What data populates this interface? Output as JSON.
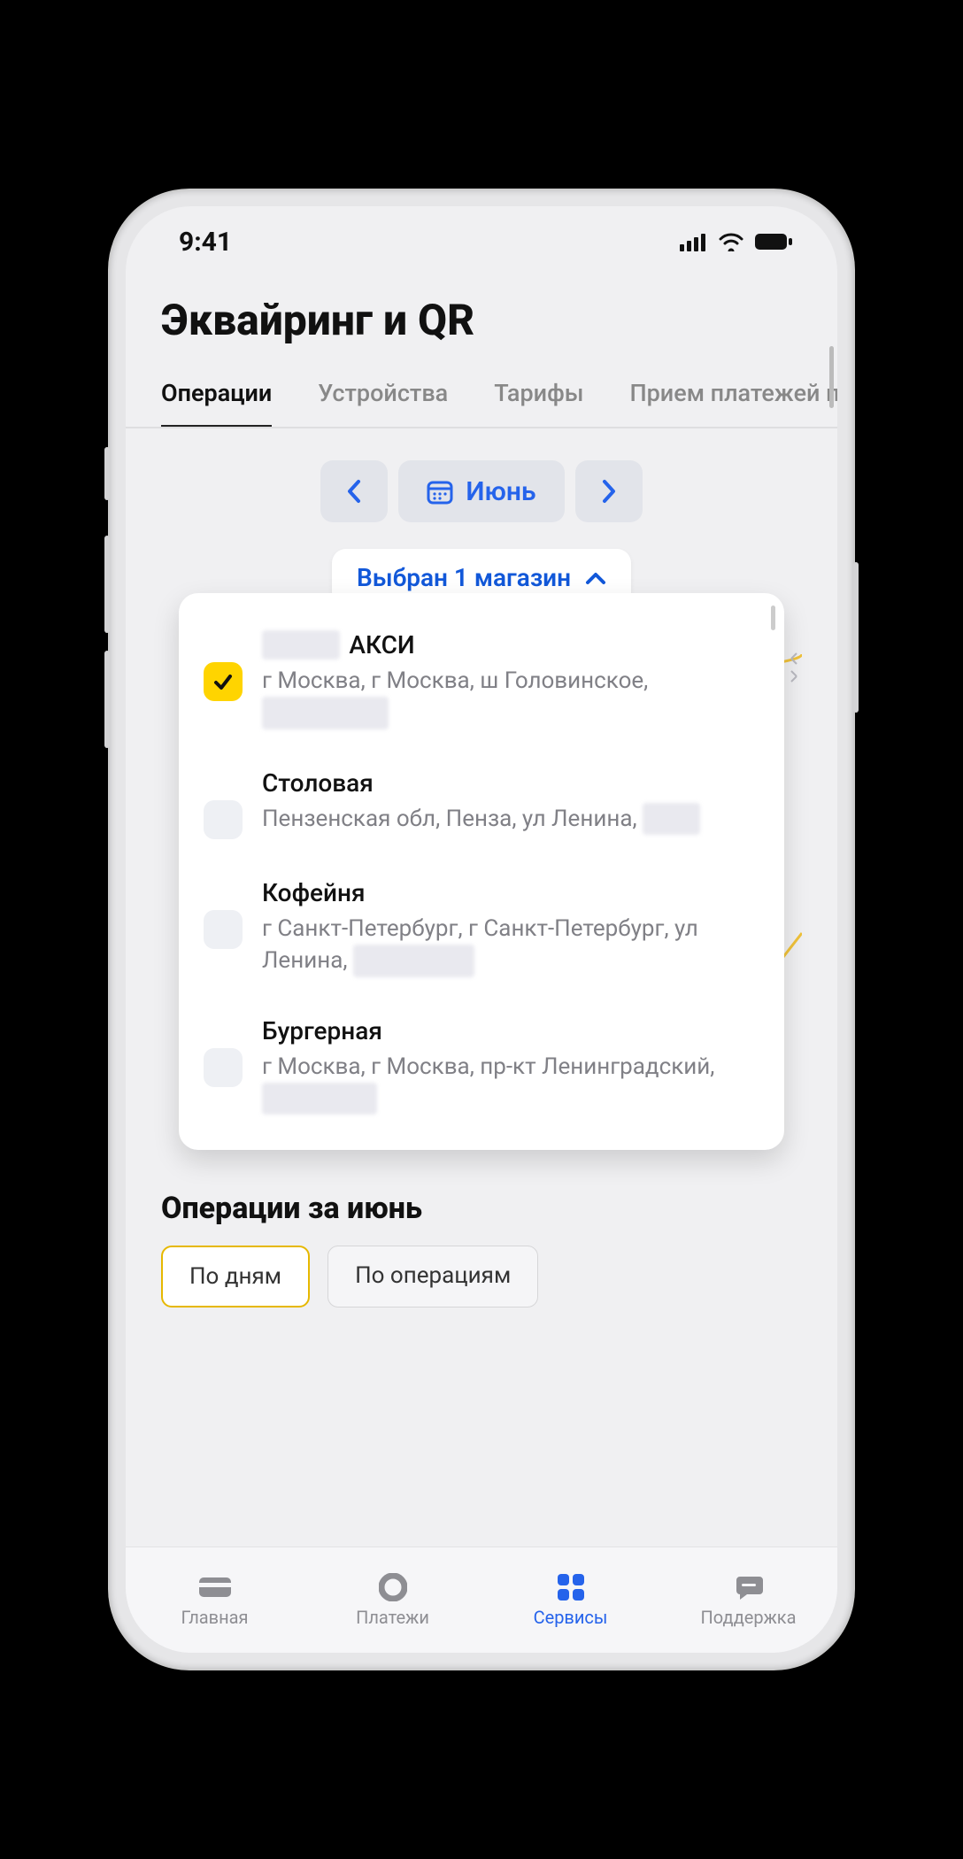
{
  "status": {
    "time": "9:41"
  },
  "header": {
    "title": "Эквайринг и QR"
  },
  "tabs": {
    "items": [
      "Операции",
      "Устройства",
      "Тарифы",
      "Прием платежей по"
    ],
    "active_index": 0
  },
  "month_picker": {
    "label": "Июнь"
  },
  "store_selector": {
    "chip_label": "Выбран 1 магазин",
    "items": [
      {
        "checked": true,
        "title_prefix_censored": "XXXXX",
        "title": "АКСИ",
        "subtitle": "г Москва, г Москва, ш Головинское,",
        "subtitle_censored_tail": "XX XXXXX X"
      },
      {
        "checked": false,
        "title": "Столовая",
        "subtitle": "Пензенская обл, Пенза, ул Ленина,",
        "subtitle_censored_tail": "XXXX"
      },
      {
        "checked": false,
        "title": "Кофейня",
        "subtitle": "г Санкт-Петербург, г Санкт-Петербург, ул Ленина,",
        "subtitle_censored_tail": "XXX XXXXX"
      },
      {
        "checked": false,
        "title": "Бургерная",
        "subtitle": "г Москва, г Москва, пр-кт Ленинградский,",
        "subtitle_censored_tail": "XXXXXXXX"
      }
    ]
  },
  "operations": {
    "section_title": "Операции за июнь",
    "segments": [
      "По дням",
      "По операциям"
    ],
    "active_segment": 0
  },
  "bottom_nav": {
    "items": [
      {
        "label": "Главная",
        "icon": "card-icon"
      },
      {
        "label": "Платежи",
        "icon": "circle-icon"
      },
      {
        "label": "Сервисы",
        "icon": "grid-icon"
      },
      {
        "label": "Поддержка",
        "icon": "chat-icon"
      }
    ],
    "active_index": 2
  }
}
